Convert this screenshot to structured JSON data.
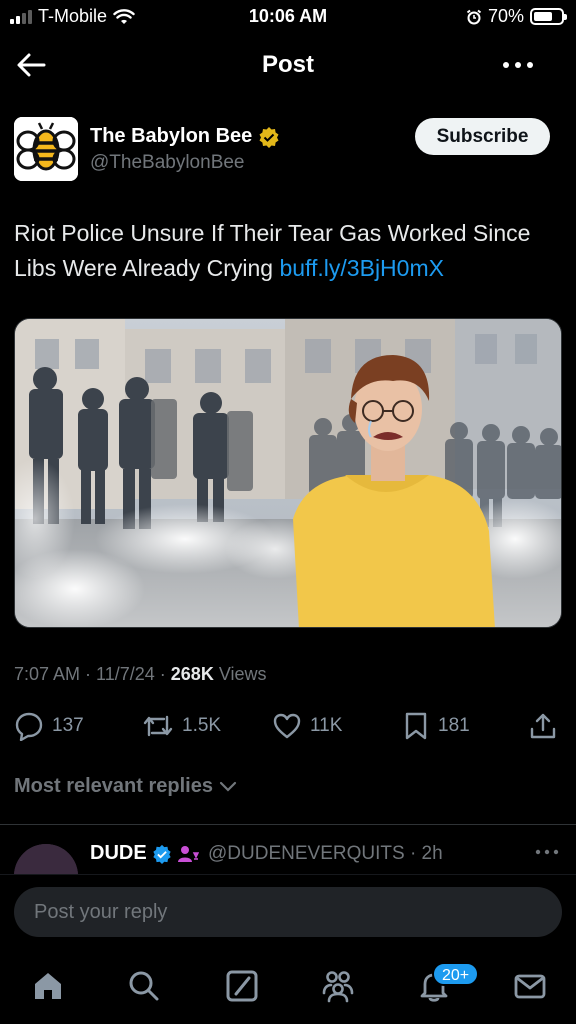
{
  "status_bar": {
    "carrier": "T-Mobile",
    "time": "10:06 AM",
    "battery": "70%",
    "battery_level": 0.7
  },
  "nav": {
    "title": "Post"
  },
  "post": {
    "author_name": "The Babylon Bee",
    "author_handle": "@TheBabylonBee",
    "subscribe_label": "Subscribe",
    "text": "Riot Police Unsure If Their Tear Gas Worked Since Libs Were Already Crying ",
    "link": "buff.ly/3BjH0mX",
    "time": "7:07 AM",
    "date": "11/7/24",
    "views_count": "268K",
    "views_label": "Views"
  },
  "actions": {
    "replies": "137",
    "reposts": "1.5K",
    "likes": "11K",
    "bookmarks": "181"
  },
  "replies": {
    "sort_label": "Most relevant replies",
    "first_reply": {
      "name": "DUDE",
      "handle": "@DUDENEVERQUITS",
      "age": "2h"
    }
  },
  "composer": {
    "placeholder": "Post your reply"
  },
  "tabbar": {
    "notifications_badge": "20+"
  },
  "colors": {
    "accent": "#1d9bf0",
    "background": "#000000",
    "verified_gold": "#e2b719"
  }
}
